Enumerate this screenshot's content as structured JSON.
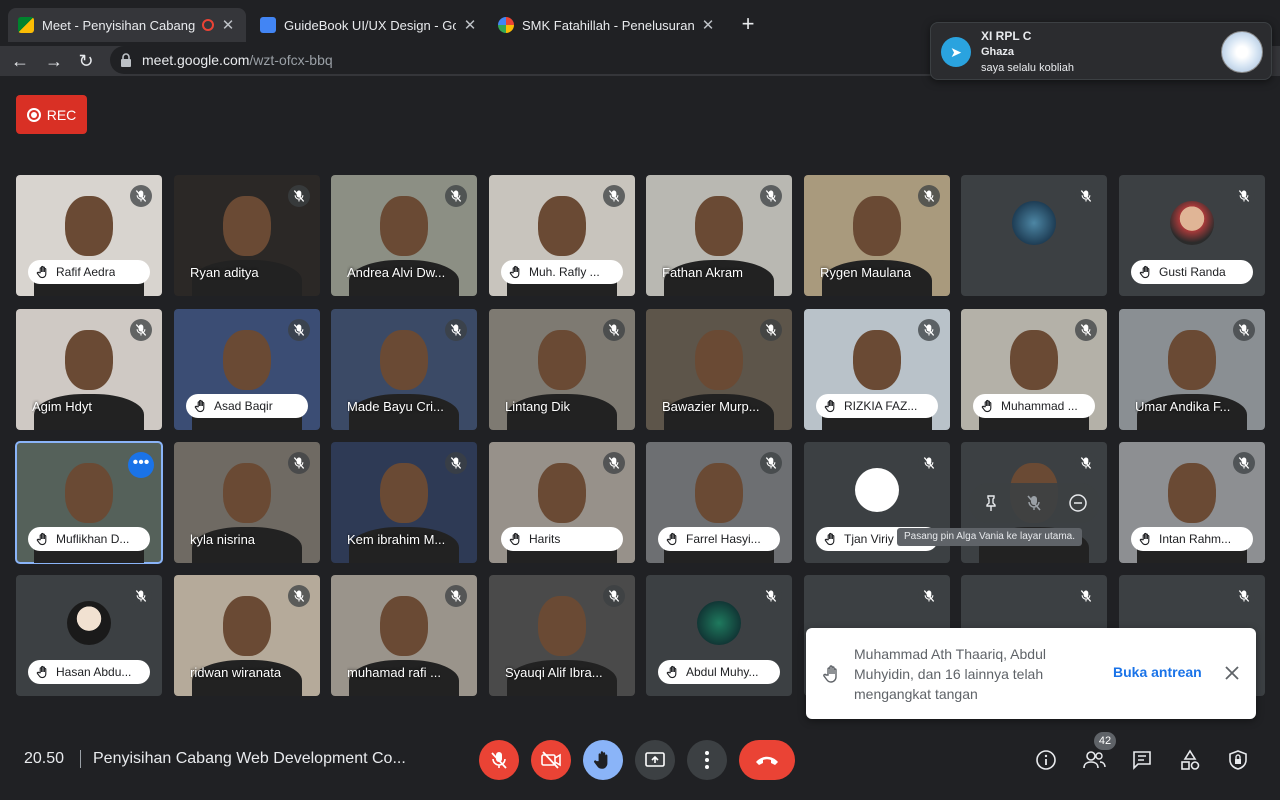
{
  "browser": {
    "tabs": [
      {
        "title": "Meet - Penyisihan Cabang",
        "active": true,
        "favicon": "meet-icon"
      },
      {
        "title": "GuideBook UI/UX Design - Goo",
        "active": false,
        "favicon": "docs-icon"
      },
      {
        "title": "SMK Fatahillah - Penelusuran G",
        "active": false,
        "favicon": "google-icon"
      }
    ],
    "url_host": "meet.google.com",
    "url_path": "/wzt-ofcx-bbq"
  },
  "notification": {
    "title": "XI RPL C",
    "sender": "Ghaza",
    "message": "saya selalu kobliah"
  },
  "rec_label": "REC",
  "participants": [
    {
      "name": "Rafif Aedra",
      "hand": true
    },
    {
      "name": "Ryan aditya",
      "hand": false
    },
    {
      "name": "Andrea Alvi Dw...",
      "hand": false
    },
    {
      "name": "Muh. Rafly ...",
      "hand": true
    },
    {
      "name": "Fathan Akram",
      "hand": false
    },
    {
      "name": "Rygen Maulana",
      "hand": false
    },
    {
      "name": "",
      "hand": false
    },
    {
      "name": "Gusti Randa",
      "hand": true
    },
    {
      "name": "Agim Hdyt",
      "hand": false
    },
    {
      "name": "Asad Baqir",
      "hand": true
    },
    {
      "name": "Made Bayu Cri...",
      "hand": false
    },
    {
      "name": "Lintang Dik",
      "hand": false
    },
    {
      "name": "Bawazier Murp...",
      "hand": false
    },
    {
      "name": "RIZKIA FAZ...",
      "hand": true
    },
    {
      "name": "Muhammad ...",
      "hand": true
    },
    {
      "name": "Umar Andika F...",
      "hand": false
    },
    {
      "name": "Muflikhan D...",
      "hand": true
    },
    {
      "name": "kyla nisrina",
      "hand": false
    },
    {
      "name": "Kem ibrahim M...",
      "hand": false
    },
    {
      "name": "Harits",
      "hand": true
    },
    {
      "name": "Farrel Hasyi...",
      "hand": true
    },
    {
      "name": "Tjan Viriy",
      "hand": true
    },
    {
      "name": "",
      "hand": false
    },
    {
      "name": "Intan Rahm...",
      "hand": true
    },
    {
      "name": "Hasan Abdu...",
      "hand": true
    },
    {
      "name": "ridwan wiranata",
      "hand": false
    },
    {
      "name": "muhamad rafi ...",
      "hand": false
    },
    {
      "name": "Syauqi Alif Ibra...",
      "hand": false
    },
    {
      "name": "Abdul Muhy...",
      "hand": true
    },
    {
      "name": "",
      "hand": false
    },
    {
      "name": "",
      "hand": false
    },
    {
      "name": "",
      "hand": false
    }
  ],
  "tooltip": "Pasang pin Alga Vania ke layar utama.",
  "toast": {
    "text": "Muhammad Ath Thaariq, Abdul Muhyidin, dan 16 lainnya telah mengangkat tangan",
    "action": "Buka antrean"
  },
  "bottom": {
    "time": "20.50",
    "meeting_title": "Penyisihan Cabang Web Development Co...",
    "people_count": "42"
  },
  "colors": {
    "accent": "#1a73e8",
    "danger": "#ea4335",
    "raised_hand": "#8ab4f8",
    "background": "#202124"
  }
}
